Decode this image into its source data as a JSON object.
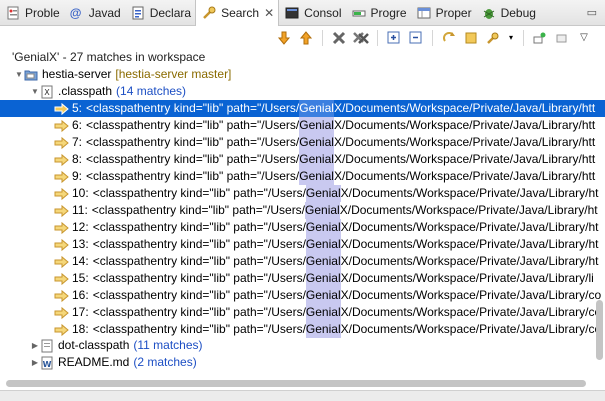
{
  "tabs": [
    {
      "label": "Proble",
      "icon": "problems-icon"
    },
    {
      "label": "Javad",
      "icon": "javadoc-icon"
    },
    {
      "label": "Declara",
      "icon": "declaration-icon"
    },
    {
      "label": "Search",
      "icon": "search-icon",
      "active": true
    },
    {
      "label": "Consol",
      "icon": "console-icon"
    },
    {
      "label": "Progre",
      "icon": "progress-icon"
    },
    {
      "label": "Proper",
      "icon": "properties-icon"
    },
    {
      "label": "Debug",
      "icon": "debug-icon"
    }
  ],
  "search": {
    "summary": "'GenialX' - 27 matches in workspace",
    "project": {
      "name": "hestia-server",
      "branch": "[hestia-server master]"
    },
    "file": {
      "name": ".classpath",
      "count": "(14 matches)"
    },
    "matches": [
      {
        "num": "5:",
        "pre": "<classpathentry kind=\"lib\" path=\"/Users/",
        "hit": "Genial",
        "hit2": "X",
        "post": "/Documents/Workspace/Private/Java/Library/htt"
      },
      {
        "num": "6:",
        "pre": "<classpathentry kind=\"lib\" path=\"/Users/",
        "hit": "Genial",
        "hit2": "X",
        "post": "/Documents/Workspace/Private/Java/Library/htt"
      },
      {
        "num": "7:",
        "pre": "<classpathentry kind=\"lib\" path=\"/Users/",
        "hit": "Genial",
        "hit2": "X",
        "post": "/Documents/Workspace/Private/Java/Library/htt"
      },
      {
        "num": "8:",
        "pre": "<classpathentry kind=\"lib\" path=\"/Users/",
        "hit": "Genial",
        "hit2": "X",
        "post": "/Documents/Workspace/Private/Java/Library/htt"
      },
      {
        "num": "9:",
        "pre": "<classpathentry kind=\"lib\" path=\"/Users/",
        "hit": "Genial",
        "hit2": "X",
        "post": "/Documents/Workspace/Private/Java/Library/htt"
      },
      {
        "num": "10:",
        "pre": "<classpathentry kind=\"lib\" path=\"/Users/",
        "hit": "Genial",
        "hit2": "X",
        "post": "/Documents/Workspace/Private/Java/Library/ht"
      },
      {
        "num": "11:",
        "pre": "<classpathentry kind=\"lib\" path=\"/Users/",
        "hit": "Genial",
        "hit2": "X",
        "post": "/Documents/Workspace/Private/Java/Library/ht"
      },
      {
        "num": "12:",
        "pre": "<classpathentry kind=\"lib\" path=\"/Users/",
        "hit": "Genial",
        "hit2": "X",
        "post": "/Documents/Workspace/Private/Java/Library/ht"
      },
      {
        "num": "13:",
        "pre": "<classpathentry kind=\"lib\" path=\"/Users/",
        "hit": "Genial",
        "hit2": "X",
        "post": "/Documents/Workspace/Private/Java/Library/ht"
      },
      {
        "num": "14:",
        "pre": "<classpathentry kind=\"lib\" path=\"/Users/",
        "hit": "Genial",
        "hit2": "X",
        "post": "/Documents/Workspace/Private/Java/Library/ht"
      },
      {
        "num": "15:",
        "pre": "<classpathentry kind=\"lib\" path=\"/Users/",
        "hit": "Genial",
        "hit2": "X",
        "post": "/Documents/Workspace/Private/Java/Library/li"
      },
      {
        "num": "16:",
        "pre": "<classpathentry kind=\"lib\" path=\"/Users/",
        "hit": "Genial",
        "hit2": "X",
        "post": "/Documents/Workspace/Private/Java/Library/co"
      },
      {
        "num": "17:",
        "pre": "<classpathentry kind=\"lib\" path=\"/Users/",
        "hit": "Genial",
        "hit2": "X",
        "post": "/Documents/Workspace/Private/Java/Library/co"
      },
      {
        "num": "18:",
        "pre": "<classpathentry kind=\"lib\" path=\"/Users/",
        "hit": "Genial",
        "hit2": "X",
        "post": "/Documents/Workspace/Private/Java/Library/co"
      }
    ],
    "other_files": [
      {
        "name": "dot-classpath",
        "count": "(11 matches)"
      },
      {
        "name": "README.md",
        "count": "(2 matches)"
      }
    ]
  },
  "colors": {
    "selection": "#0a63d3",
    "highlight": "#c9c9f0",
    "match_count": "#1d4fc4",
    "branch": "#8a6b00"
  }
}
